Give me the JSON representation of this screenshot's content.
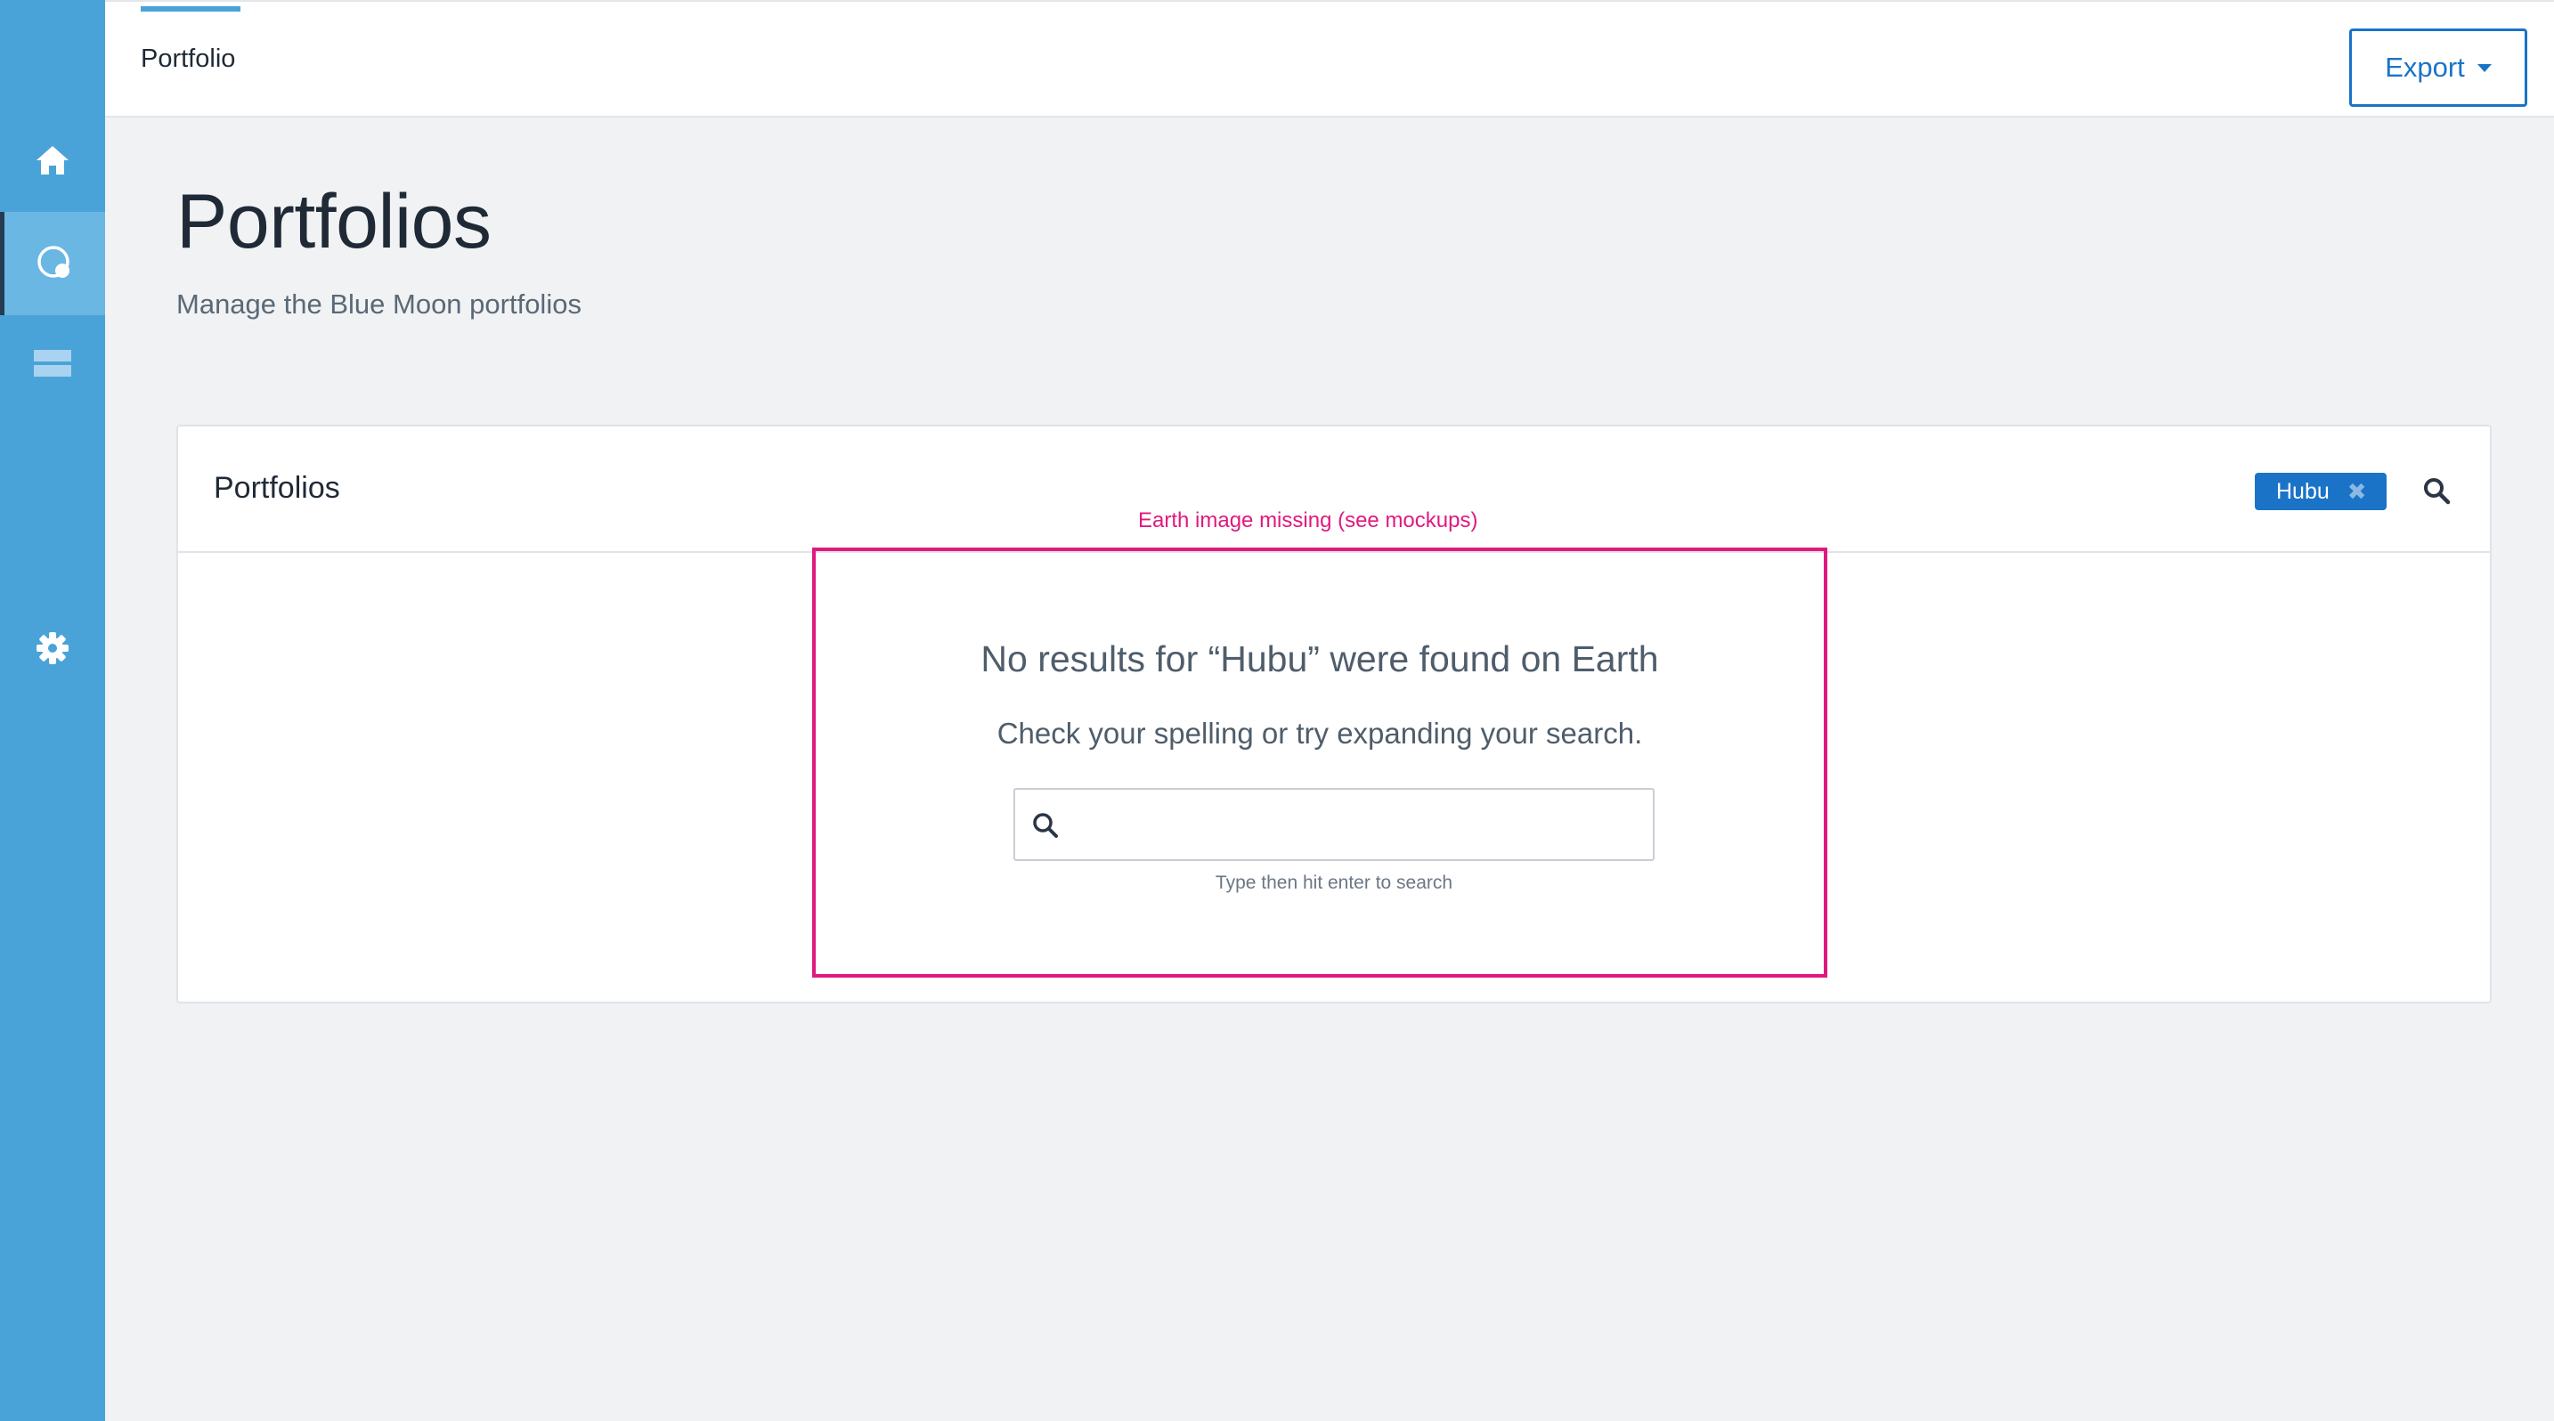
{
  "nav": {
    "tab_label": "Portfolio",
    "sidebar_icons": [
      "home-icon",
      "portfolio-icon",
      "list-icon",
      "gear-icon"
    ]
  },
  "toolbar": {
    "export_label": "Export"
  },
  "page": {
    "title": "Portfolios",
    "subtitle": "Manage the Blue Moon portfolios"
  },
  "card": {
    "title": "Portfolios",
    "filter_chip": "Hubu",
    "chip_remove": "✖"
  },
  "annotation": {
    "note": "Earth image missing (see mockups)"
  },
  "empty_state": {
    "title": "No results for “Hubu” were found on Earth",
    "message": "Check your spelling or try expanding your search.",
    "search_value": "",
    "search_hint": "Type then hit enter to search"
  },
  "colors": {
    "sidebar": "#4aa3d8",
    "accent": "#1a73c7",
    "annotation": "#e0197f"
  }
}
